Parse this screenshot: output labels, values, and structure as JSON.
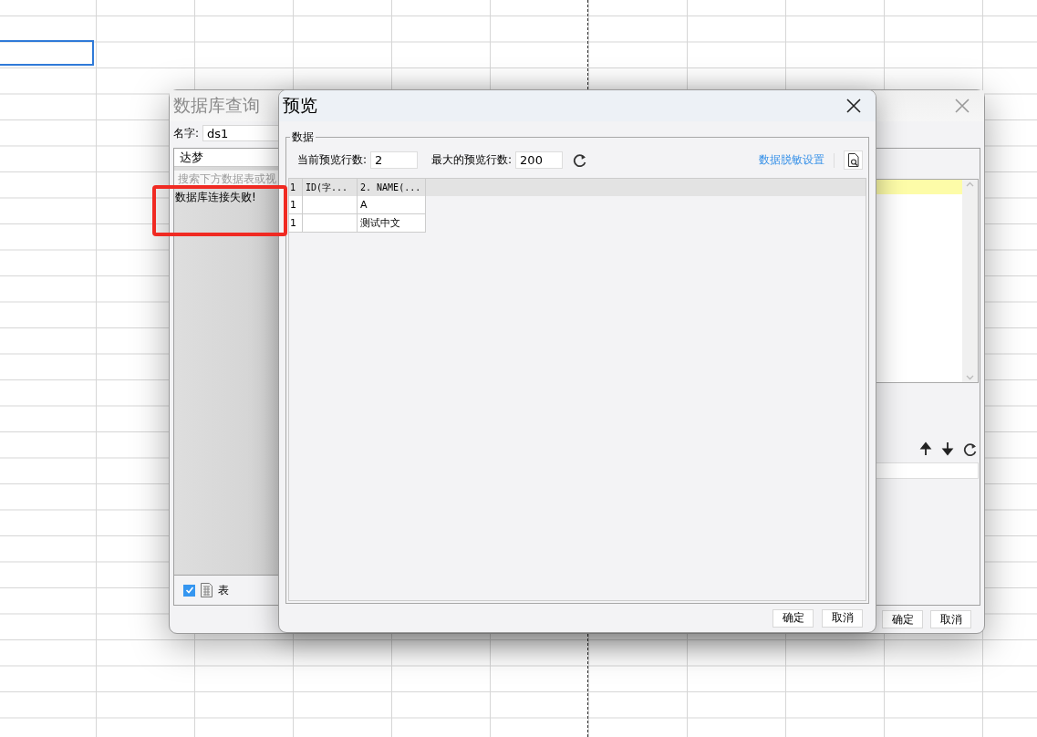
{
  "query_dialog": {
    "title": "数据库查询",
    "name_label": "名字:",
    "name_value": "ds1",
    "database": "达梦",
    "search_placeholder": "搜索下方数据表或视",
    "error": "数据库连接失败!",
    "show_tables": {
      "checked": true,
      "label": "表"
    },
    "buttons": [
      "确定",
      "取消"
    ]
  },
  "preview_dialog": {
    "title": "预览",
    "group_title": "数据",
    "current_rows_label": "当前预览行数:",
    "current_rows": "2",
    "max_rows_label": "最大的预览行数:",
    "max_rows": "200",
    "masking_link": "数据脱敏设置",
    "table": {
      "columns": [
        "1",
        "ID(字...",
        "2. NAME(..."
      ],
      "rows": [
        {
          "index": "1",
          "name": "A"
        },
        {
          "index": "1",
          "name": "测试中文"
        }
      ]
    },
    "buttons": [
      "确定",
      "取消"
    ]
  }
}
